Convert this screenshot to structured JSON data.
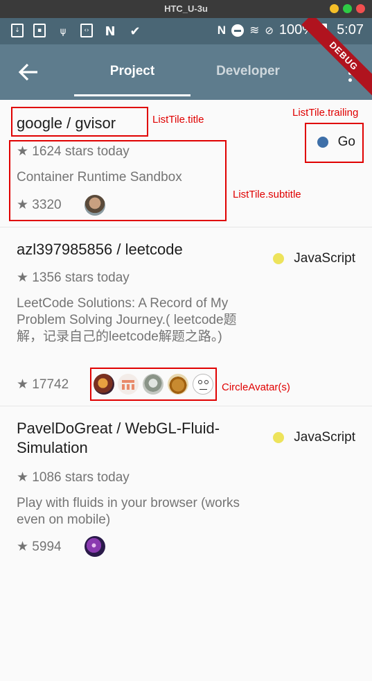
{
  "window": {
    "title": "HTC_U-3u"
  },
  "status_bar": {
    "battery": "100%",
    "time": "5:07"
  },
  "app_bar": {
    "tabs": [
      {
        "label": "Project"
      },
      {
        "label": "Developer"
      }
    ],
    "debug_banner": "DEBUG"
  },
  "repos": [
    {
      "title": "google / gvisor",
      "stars_today": "★ 1624 stars today",
      "description": "Container Runtime Sandbox",
      "stars": "★ 3320",
      "language": "Go",
      "language_color": "#3e6fa8"
    },
    {
      "title": "azl397985856 / leetcode",
      "stars_today": "★ 1356 stars today",
      "description": "LeetCode Solutions: A Record of My Problem Solving Journey.( leetcode题解，记录自己的leetcode解题之路。)",
      "stars": "★ 17742",
      "language": "JavaScript",
      "language_color": "#ede35b"
    },
    {
      "title": "PavelDoGreat / WebGL-Fluid-Simulation",
      "stars_today": "★ 1086 stars today",
      "description": "Play with fluids in your browser (works even on mobile)",
      "stars": "★ 5994",
      "language": "JavaScript",
      "language_color": "#ede35b"
    }
  ],
  "annotations": {
    "title": "ListTile.title",
    "trailing": "ListTile.trailing",
    "subtitle": "ListTile.subtitle",
    "avatars": "CircleAvatar(s)"
  }
}
